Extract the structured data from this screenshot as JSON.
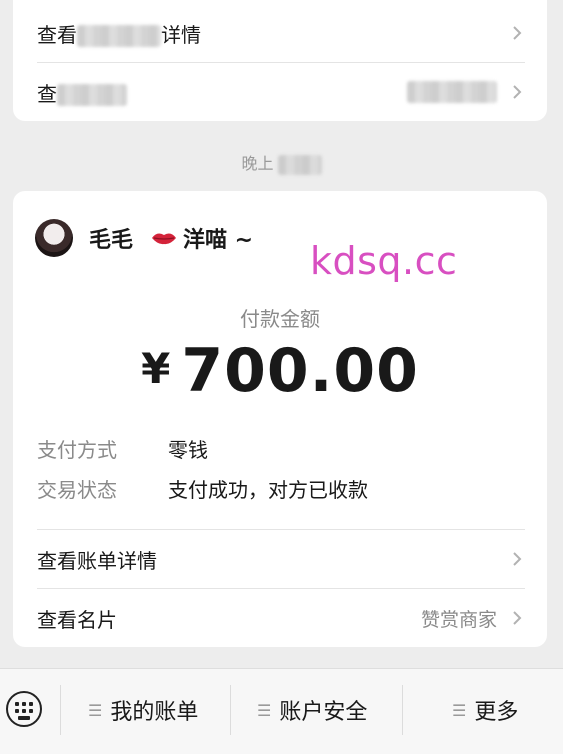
{
  "top_card": {
    "row1_label_visible": "查看",
    "row1_label_tail": "详情",
    "row2_label_visible": "查"
  },
  "time_label": "晚上",
  "payee": {
    "name": "毛毛",
    "nickname": "洋喵 ~"
  },
  "watermark": "kdsq.cc",
  "payment": {
    "amount_label": "付款金额",
    "currency": "¥",
    "amount": "700.00",
    "method_label": "支付方式",
    "method_value": "零钱",
    "status_label": "交易状态",
    "status_value": "支付成功，对方已收款"
  },
  "rows": {
    "bill_details": "查看账单详情",
    "business_card": "查看名片",
    "business_card_right": "赞赏商家"
  },
  "bottom_menu": {
    "items": [
      {
        "label": "我的账单"
      },
      {
        "label": "账户安全"
      },
      {
        "label": "更多"
      }
    ]
  },
  "colors": {
    "background": "#ededed",
    "card": "#ffffff",
    "watermark": "#d84fc1"
  },
  "icons": [
    "chevron-right-icon",
    "keyboard-icon",
    "menu-icon",
    "lips-emoji-icon"
  ]
}
